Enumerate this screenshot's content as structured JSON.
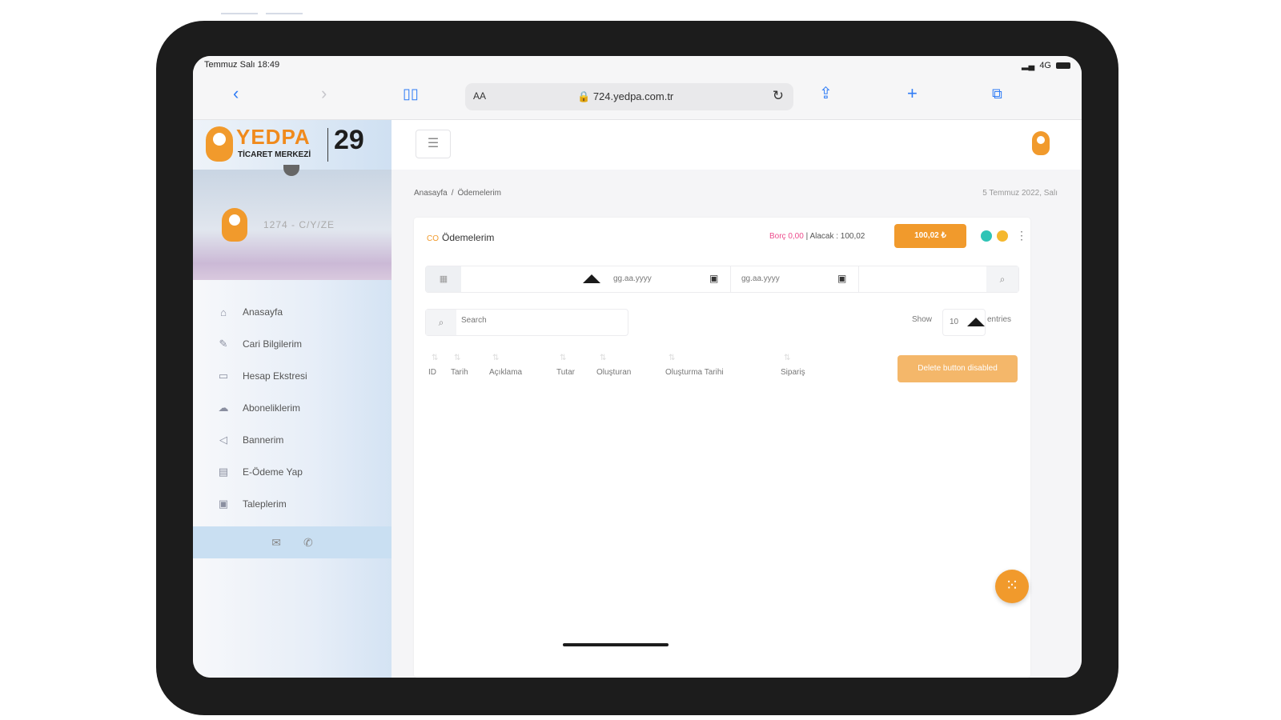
{
  "status_bar": {
    "time": "Temmuz Salı 18:49",
    "signal": "4G"
  },
  "browser": {
    "aa": "AA",
    "url": "724.yedpa.com.tr"
  },
  "brand": {
    "name": "YEDPA",
    "subtitle": "TİCARET MERKEZİ",
    "anniversary": "29"
  },
  "profile": {
    "name": "1274 - C/Y/ZE"
  },
  "sidebar": {
    "items": [
      {
        "label": "Anasayfa",
        "icon": "home-icon",
        "glyph": "⌂"
      },
      {
        "label": "Cari Bilgilerim",
        "icon": "pencil-icon",
        "glyph": "✎"
      },
      {
        "label": "Hesap Ekstresi",
        "icon": "money-icon",
        "glyph": "▭"
      },
      {
        "label": "Aboneliklerim",
        "icon": "cloud-icon",
        "glyph": "☁"
      },
      {
        "label": "Bannerim",
        "icon": "megaphone-icon",
        "glyph": "◁"
      },
      {
        "label": "E-Ödeme Yap",
        "icon": "credit-card-icon",
        "glyph": "▤"
      },
      {
        "label": "Taleplerim",
        "icon": "ticket-icon",
        "glyph": "▣"
      }
    ],
    "footer": {
      "mail_glyph": "✉",
      "phone_glyph": "✆"
    }
  },
  "breadcrumb": {
    "home": "Anasayfa",
    "separator": "/",
    "current": "Ödemelerim"
  },
  "date_text": "5 Temmuz 2022, Salı",
  "card": {
    "title_icon": "CO",
    "title": "Ödemelerim",
    "debt": "Borç 0,00",
    "separator": "|",
    "credit": "Alacak : 100,02",
    "total_button": "100,02 ₺",
    "filter": {
      "date_from": "gg.aa.yyyy",
      "date_to": "gg.aa.yyyy"
    },
    "search_placeholder": "Search",
    "show_label": "Show",
    "show_value": "10",
    "entries_label": "entries",
    "columns": [
      "ID",
      "Tarih",
      "Açıklama",
      "Tutar",
      "Oluşturan",
      "Oluşturma Tarihi",
      "Sipariş"
    ],
    "delete_button": "Delete button disabled"
  },
  "colors": {
    "accent": "#f19a2c",
    "debt": "#ec4c8c",
    "dot_green": "#2ec4b6",
    "dot_yellow": "#f5b82e"
  }
}
